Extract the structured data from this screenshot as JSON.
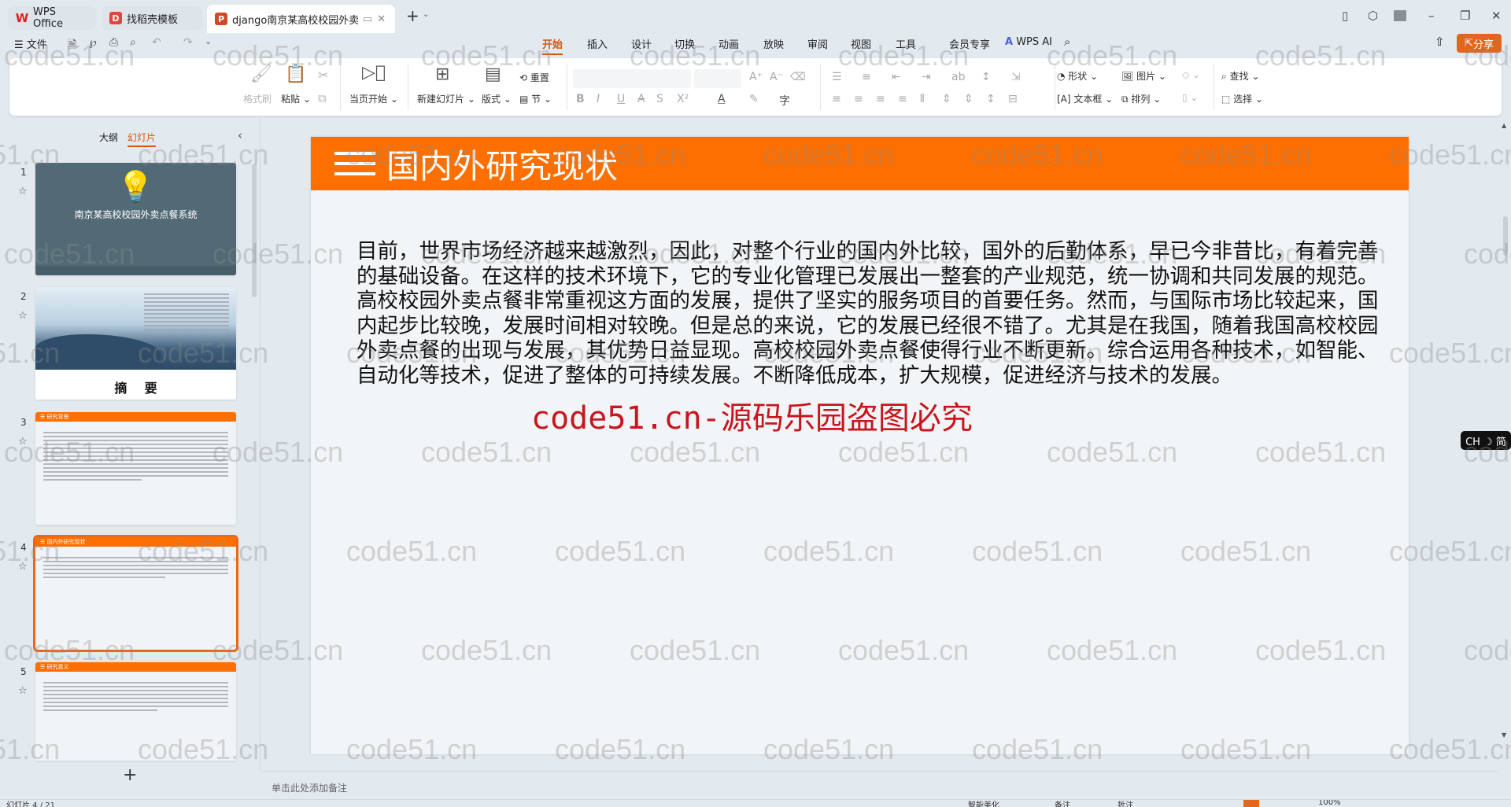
{
  "tabs": [
    {
      "label": "WPS Office",
      "icon": "wps-logo",
      "color": "#d9261c"
    },
    {
      "label": "找稻壳模板",
      "icon": "docer-logo",
      "color": "#e0463c"
    },
    {
      "label": "django南京某高校校园外卖",
      "icon": "ppt-logo",
      "color": "#d24726",
      "active": true
    }
  ],
  "tab_new": "+",
  "menu": {
    "file": "文件",
    "items": [
      "开始",
      "插入",
      "设计",
      "切换",
      "动画",
      "放映",
      "审阅",
      "视图",
      "工具",
      "会员专享"
    ],
    "active": "开始",
    "ai": "WPS AI",
    "share": "分享"
  },
  "ribbon": {
    "format_painter": "格式刷",
    "paste": "粘贴",
    "play_from_current": "当页开始",
    "new_slide": "新建幻灯片",
    "layout": "版式",
    "reset": "重置",
    "section": "节",
    "shape": "形状",
    "picture": "图片",
    "textbox": "文本框",
    "arrange": "排列",
    "find": "查找",
    "select": "选择"
  },
  "left_panel": {
    "tab_outline": "大纲",
    "tab_slides": "幻灯片",
    "add": "+",
    "slides": [
      {
        "num": "1",
        "title": "南京某高校校园外卖点餐系统"
      },
      {
        "num": "2",
        "title": "摘    要"
      },
      {
        "num": "3",
        "title": "研究背景"
      },
      {
        "num": "4",
        "title": "国内外研究现状",
        "selected": true
      },
      {
        "num": "5",
        "title": "研究意义"
      }
    ]
  },
  "slide": {
    "title": "国内外研究现状",
    "lines": [
      "目前，世界市场经济越来越激烈，因此，对整个行业的国内外比较，国外的后勤体系，早已今非昔比，有着完善",
      "的基础设备。在这样的技术环境下，它的专业化管理已发展出一整套的产业规范，统一协调和共同发展的规范。",
      "高校校园外卖点餐非常重视这方面的发展，提供了坚实的服务项目的首要任务。然而，与国际市场比较起来，国",
      "内起步比较晚，发展时间相对较晚。但是总的来说，它的发展已经很不错了。尤其是在我国，随着我国高校校园",
      "外卖点餐的出现与发展，其优势日益显现。高校校园外卖点餐使得行业不断更新。综合运用各种技术，如智能、",
      "自动化等技术，促进了整体的可持续发展。不断降低成本，扩大规模，促进经济与技术的发展。"
    ],
    "red_watermark": "code51.cn-源码乐园盗图必究"
  },
  "notes_placeholder": "单击此处添加备注",
  "status": {
    "slide_counter": "幻灯片 4 / 21",
    "beautify": "智能美化",
    "notes": "备注",
    "comments": "批注",
    "zoom": "100%"
  },
  "ime": "CH ☽ 简",
  "watermark": "code51.cn",
  "colors": {
    "accent": "#fd6f00",
    "share": "#e2671e",
    "active_tab": "#d8570f"
  }
}
